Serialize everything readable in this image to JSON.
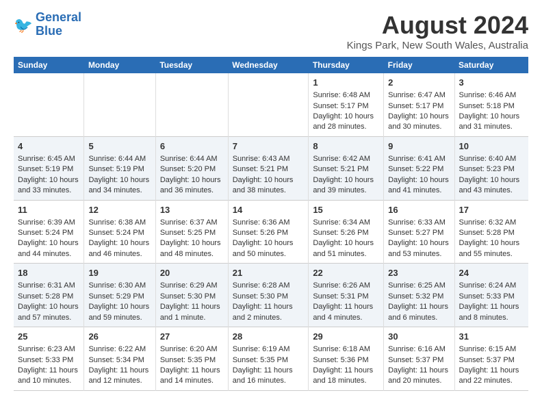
{
  "logo": {
    "line1": "General",
    "line2": "Blue"
  },
  "title": "August 2024",
  "subtitle": "Kings Park, New South Wales, Australia",
  "days_of_week": [
    "Sunday",
    "Monday",
    "Tuesday",
    "Wednesday",
    "Thursday",
    "Friday",
    "Saturday"
  ],
  "weeks": [
    [
      {
        "day": "",
        "sunrise": "",
        "sunset": "",
        "daylight": ""
      },
      {
        "day": "",
        "sunrise": "",
        "sunset": "",
        "daylight": ""
      },
      {
        "day": "",
        "sunrise": "",
        "sunset": "",
        "daylight": ""
      },
      {
        "day": "",
        "sunrise": "",
        "sunset": "",
        "daylight": ""
      },
      {
        "day": "1",
        "sunrise": "Sunrise: 6:48 AM",
        "sunset": "Sunset: 5:17 PM",
        "daylight": "Daylight: 10 hours and 28 minutes."
      },
      {
        "day": "2",
        "sunrise": "Sunrise: 6:47 AM",
        "sunset": "Sunset: 5:17 PM",
        "daylight": "Daylight: 10 hours and 30 minutes."
      },
      {
        "day": "3",
        "sunrise": "Sunrise: 6:46 AM",
        "sunset": "Sunset: 5:18 PM",
        "daylight": "Daylight: 10 hours and 31 minutes."
      }
    ],
    [
      {
        "day": "4",
        "sunrise": "Sunrise: 6:45 AM",
        "sunset": "Sunset: 5:19 PM",
        "daylight": "Daylight: 10 hours and 33 minutes."
      },
      {
        "day": "5",
        "sunrise": "Sunrise: 6:44 AM",
        "sunset": "Sunset: 5:19 PM",
        "daylight": "Daylight: 10 hours and 34 minutes."
      },
      {
        "day": "6",
        "sunrise": "Sunrise: 6:44 AM",
        "sunset": "Sunset: 5:20 PM",
        "daylight": "Daylight: 10 hours and 36 minutes."
      },
      {
        "day": "7",
        "sunrise": "Sunrise: 6:43 AM",
        "sunset": "Sunset: 5:21 PM",
        "daylight": "Daylight: 10 hours and 38 minutes."
      },
      {
        "day": "8",
        "sunrise": "Sunrise: 6:42 AM",
        "sunset": "Sunset: 5:21 PM",
        "daylight": "Daylight: 10 hours and 39 minutes."
      },
      {
        "day": "9",
        "sunrise": "Sunrise: 6:41 AM",
        "sunset": "Sunset: 5:22 PM",
        "daylight": "Daylight: 10 hours and 41 minutes."
      },
      {
        "day": "10",
        "sunrise": "Sunrise: 6:40 AM",
        "sunset": "Sunset: 5:23 PM",
        "daylight": "Daylight: 10 hours and 43 minutes."
      }
    ],
    [
      {
        "day": "11",
        "sunrise": "Sunrise: 6:39 AM",
        "sunset": "Sunset: 5:24 PM",
        "daylight": "Daylight: 10 hours and 44 minutes."
      },
      {
        "day": "12",
        "sunrise": "Sunrise: 6:38 AM",
        "sunset": "Sunset: 5:24 PM",
        "daylight": "Daylight: 10 hours and 46 minutes."
      },
      {
        "day": "13",
        "sunrise": "Sunrise: 6:37 AM",
        "sunset": "Sunset: 5:25 PM",
        "daylight": "Daylight: 10 hours and 48 minutes."
      },
      {
        "day": "14",
        "sunrise": "Sunrise: 6:36 AM",
        "sunset": "Sunset: 5:26 PM",
        "daylight": "Daylight: 10 hours and 50 minutes."
      },
      {
        "day": "15",
        "sunrise": "Sunrise: 6:34 AM",
        "sunset": "Sunset: 5:26 PM",
        "daylight": "Daylight: 10 hours and 51 minutes."
      },
      {
        "day": "16",
        "sunrise": "Sunrise: 6:33 AM",
        "sunset": "Sunset: 5:27 PM",
        "daylight": "Daylight: 10 hours and 53 minutes."
      },
      {
        "day": "17",
        "sunrise": "Sunrise: 6:32 AM",
        "sunset": "Sunset: 5:28 PM",
        "daylight": "Daylight: 10 hours and 55 minutes."
      }
    ],
    [
      {
        "day": "18",
        "sunrise": "Sunrise: 6:31 AM",
        "sunset": "Sunset: 5:28 PM",
        "daylight": "Daylight: 10 hours and 57 minutes."
      },
      {
        "day": "19",
        "sunrise": "Sunrise: 6:30 AM",
        "sunset": "Sunset: 5:29 PM",
        "daylight": "Daylight: 10 hours and 59 minutes."
      },
      {
        "day": "20",
        "sunrise": "Sunrise: 6:29 AM",
        "sunset": "Sunset: 5:30 PM",
        "daylight": "Daylight: 11 hours and 1 minute."
      },
      {
        "day": "21",
        "sunrise": "Sunrise: 6:28 AM",
        "sunset": "Sunset: 5:30 PM",
        "daylight": "Daylight: 11 hours and 2 minutes."
      },
      {
        "day": "22",
        "sunrise": "Sunrise: 6:26 AM",
        "sunset": "Sunset: 5:31 PM",
        "daylight": "Daylight: 11 hours and 4 minutes."
      },
      {
        "day": "23",
        "sunrise": "Sunrise: 6:25 AM",
        "sunset": "Sunset: 5:32 PM",
        "daylight": "Daylight: 11 hours and 6 minutes."
      },
      {
        "day": "24",
        "sunrise": "Sunrise: 6:24 AM",
        "sunset": "Sunset: 5:33 PM",
        "daylight": "Daylight: 11 hours and 8 minutes."
      }
    ],
    [
      {
        "day": "25",
        "sunrise": "Sunrise: 6:23 AM",
        "sunset": "Sunset: 5:33 PM",
        "daylight": "Daylight: 11 hours and 10 minutes."
      },
      {
        "day": "26",
        "sunrise": "Sunrise: 6:22 AM",
        "sunset": "Sunset: 5:34 PM",
        "daylight": "Daylight: 11 hours and 12 minutes."
      },
      {
        "day": "27",
        "sunrise": "Sunrise: 6:20 AM",
        "sunset": "Sunset: 5:35 PM",
        "daylight": "Daylight: 11 hours and 14 minutes."
      },
      {
        "day": "28",
        "sunrise": "Sunrise: 6:19 AM",
        "sunset": "Sunset: 5:35 PM",
        "daylight": "Daylight: 11 hours and 16 minutes."
      },
      {
        "day": "29",
        "sunrise": "Sunrise: 6:18 AM",
        "sunset": "Sunset: 5:36 PM",
        "daylight": "Daylight: 11 hours and 18 minutes."
      },
      {
        "day": "30",
        "sunrise": "Sunrise: 6:16 AM",
        "sunset": "Sunset: 5:37 PM",
        "daylight": "Daylight: 11 hours and 20 minutes."
      },
      {
        "day": "31",
        "sunrise": "Sunrise: 6:15 AM",
        "sunset": "Sunset: 5:37 PM",
        "daylight": "Daylight: 11 hours and 22 minutes."
      }
    ]
  ]
}
